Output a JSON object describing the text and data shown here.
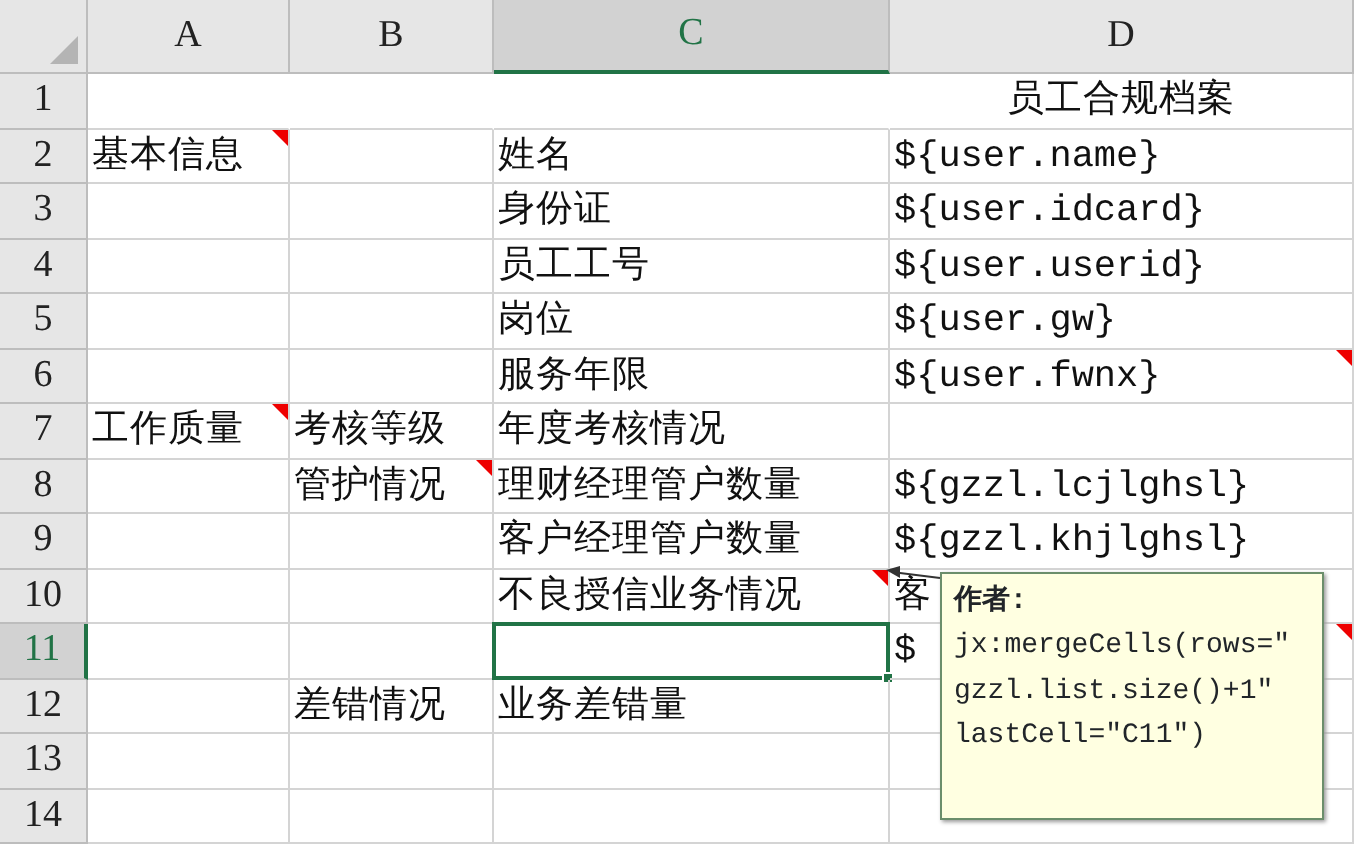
{
  "columns": [
    {
      "label": "A",
      "selected": false
    },
    {
      "label": "B",
      "selected": false
    },
    {
      "label": "C",
      "selected": true
    },
    {
      "label": "D",
      "selected": false
    }
  ],
  "rows": [
    {
      "number": "1",
      "selected": false,
      "merged": true,
      "column_d": {
        "text": "员工合规档案",
        "has_comment": false
      }
    },
    {
      "number": "2",
      "selected": false,
      "column_a": {
        "text": "基本信息",
        "has_comment": true
      },
      "column_c": {
        "text": "姓名",
        "has_comment": false
      },
      "column_d": {
        "text": "${user.name}",
        "has_comment": false
      }
    },
    {
      "number": "3",
      "selected": false,
      "column_c": {
        "text": "身份证",
        "has_comment": false
      },
      "column_d": {
        "text": "${user.idcard}",
        "has_comment": false
      }
    },
    {
      "number": "4",
      "selected": false,
      "column_c": {
        "text": "员工工号",
        "has_comment": false
      },
      "column_d": {
        "text": "${user.userid}",
        "has_comment": false
      }
    },
    {
      "number": "5",
      "selected": false,
      "column_c": {
        "text": "岗位",
        "has_comment": false
      },
      "column_d": {
        "text": "${user.gw}",
        "has_comment": false
      }
    },
    {
      "number": "6",
      "selected": false,
      "column_c": {
        "text": "服务年限",
        "has_comment": false
      },
      "column_d": {
        "text": "${user.fwnx}",
        "has_comment": true
      }
    },
    {
      "number": "7",
      "selected": false,
      "column_a": {
        "text": "工作质量",
        "has_comment": true
      },
      "column_b": {
        "text": "考核等级",
        "has_comment": false
      },
      "column_c": {
        "text": "年度考核情况",
        "has_comment": false
      }
    },
    {
      "number": "8",
      "selected": false,
      "column_b": {
        "text": "管护情况",
        "has_comment": true
      },
      "column_c": {
        "text": "理财经理管户数量",
        "has_comment": false
      },
      "column_d": {
        "text": "${gzzl.lcjlghsl}",
        "has_comment": false
      }
    },
    {
      "number": "9",
      "selected": false,
      "column_c": {
        "text": "客户经理管户数量",
        "has_comment": false
      },
      "column_d": {
        "text": "${gzzl.khjlghsl}",
        "has_comment": false
      }
    },
    {
      "number": "10",
      "selected": false,
      "column_c": {
        "text": "不良授信业务情况",
        "has_comment": true
      },
      "column_d": {
        "text": "客",
        "has_comment": false
      }
    },
    {
      "number": "11",
      "selected": true,
      "column_d": {
        "text": "$",
        "has_comment": true
      }
    },
    {
      "number": "12",
      "selected": false,
      "column_b": {
        "text": "差错情况",
        "has_comment": false
      },
      "column_c": {
        "text": "业务差错量",
        "has_comment": false
      }
    },
    {
      "number": "13",
      "selected": false
    },
    {
      "number": "14",
      "selected": false
    }
  ],
  "comment": {
    "author": "作者:",
    "lines": [
      "jx:mergeCells(rows=\"",
      "gzzl.list.size()+1\"",
      "lastCell=\"C11\")"
    ]
  }
}
